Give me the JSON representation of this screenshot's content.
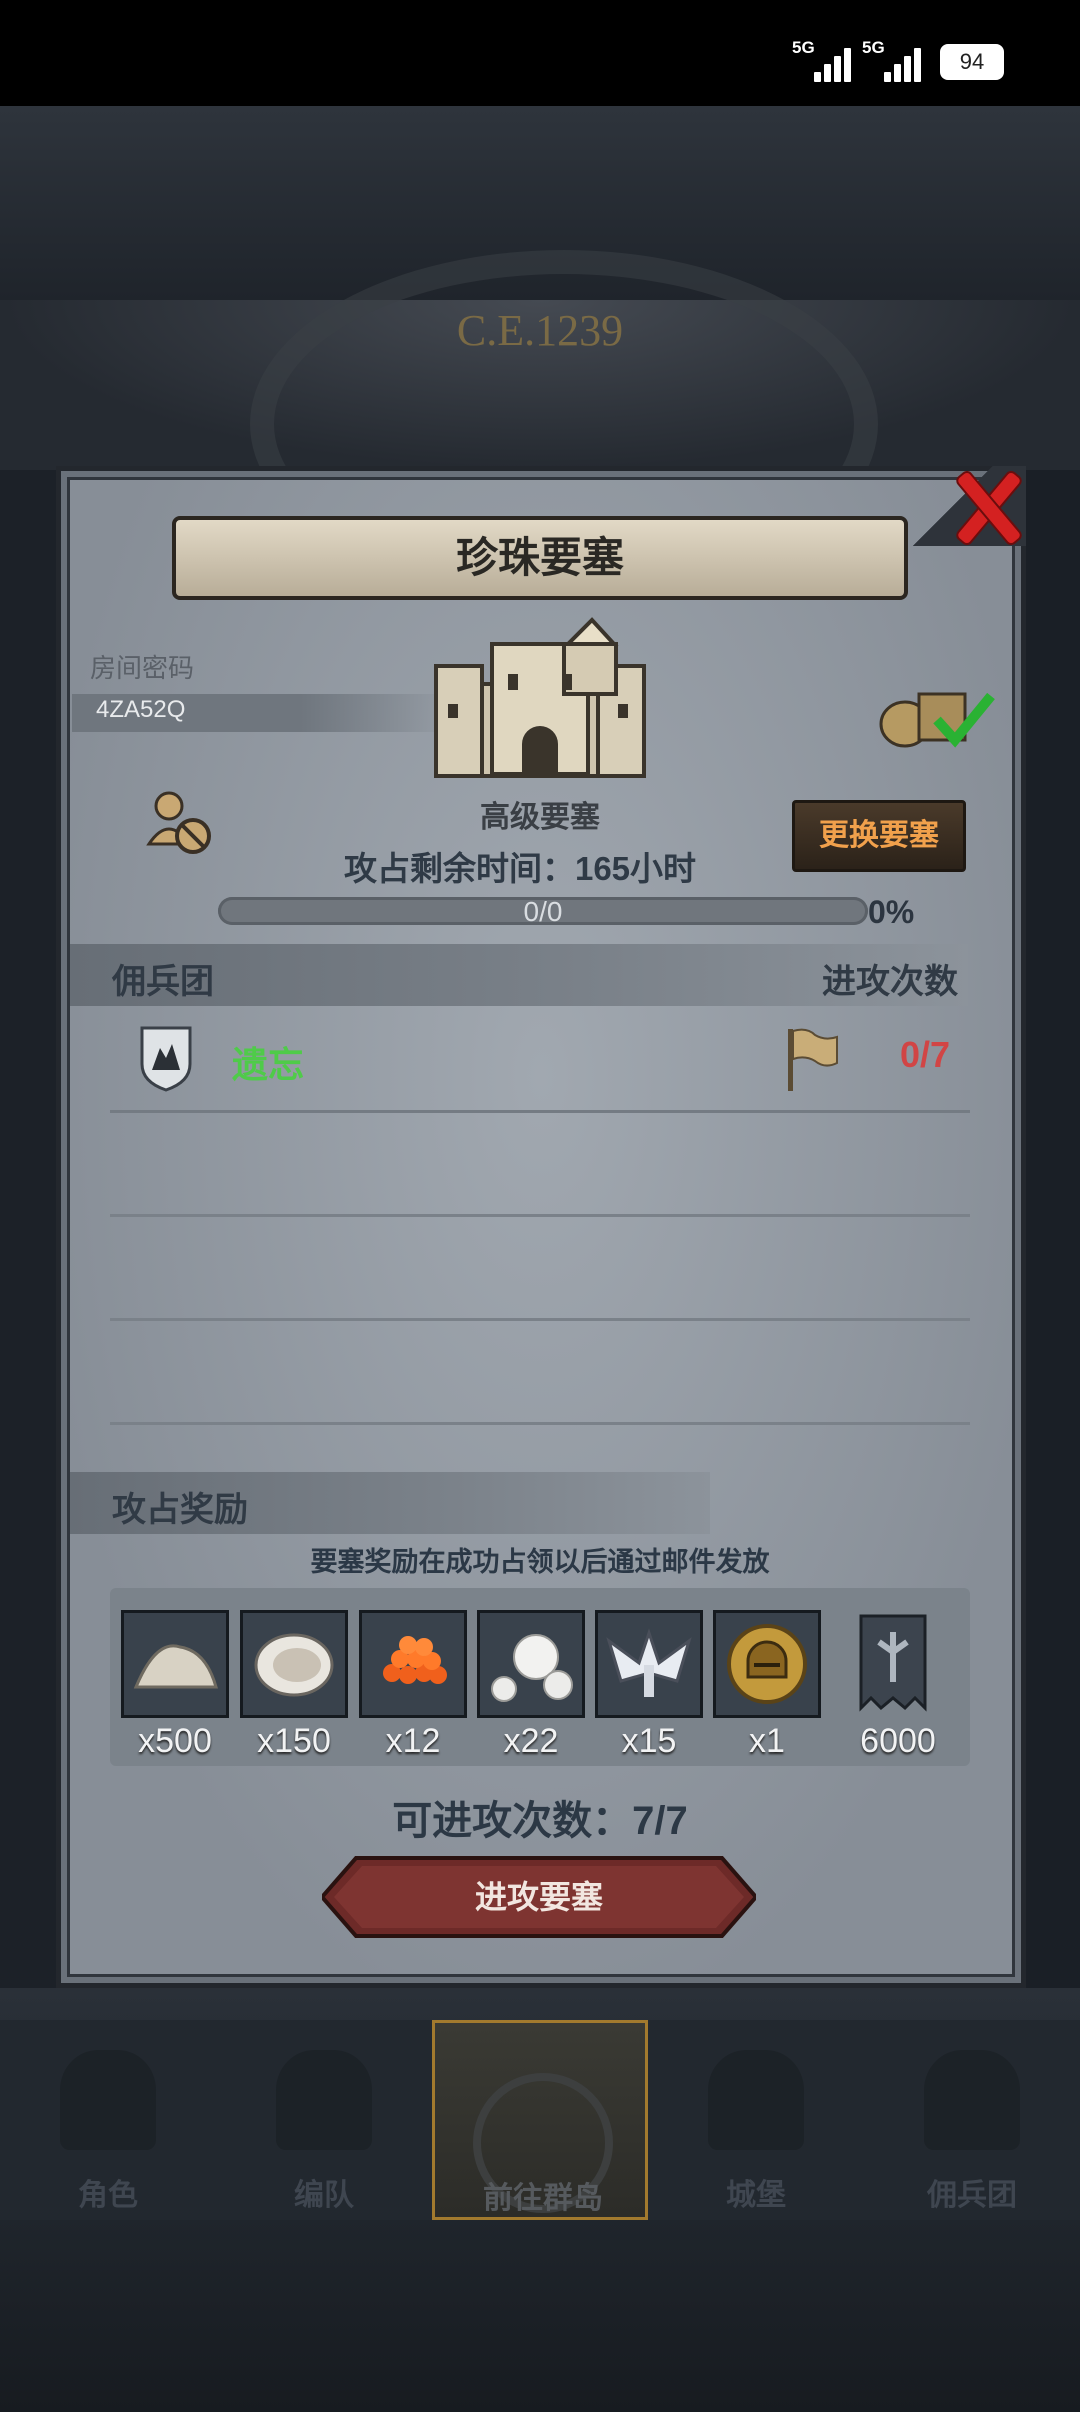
{
  "status_bar": {
    "signal1_label": "5G",
    "signal2_label": "5G",
    "battery": "94"
  },
  "header": {
    "era": "C.E.1239"
  },
  "modal": {
    "title": "珍珠要塞",
    "room_code_label": "房间密码",
    "room_code": "4ZA52Q",
    "fortress_level": "高级要塞",
    "swap_button": "更换要塞",
    "timer_text": "攻占剩余时间：165小时",
    "progress_text": "0/0",
    "progress_fraction": 0,
    "progress_percent": "0%",
    "mercenary_header": "佣兵团",
    "attacks_header": "进攻次数",
    "guilds": [
      {
        "name": "遗忘",
        "attacks": "0/7"
      }
    ],
    "rewards_header": "攻占奖励",
    "rewards_note": "要塞奖励在成功占领以后通过邮件发放",
    "rewards": [
      {
        "icon": "salt-pile-icon",
        "qty": "x500"
      },
      {
        "icon": "oyster-icon",
        "qty": "x150"
      },
      {
        "icon": "fish-roe-icon",
        "qty": "x12"
      },
      {
        "icon": "pearl-icon",
        "qty": "x22"
      },
      {
        "icon": "winged-emblem-icon",
        "qty": "x15"
      },
      {
        "icon": "helmet-coin-icon",
        "qty": "x1"
      },
      {
        "icon": "banner-icon",
        "qty": "6000"
      }
    ],
    "remaining_attacks": "可进攻次数：7/7",
    "attack_button": "进攻要塞"
  },
  "nav": {
    "items": [
      {
        "label": "角色",
        "icon": "character-icon"
      },
      {
        "label": "编队",
        "icon": "formation-icon"
      },
      {
        "label": "前往群岛",
        "icon": "archipelago-icon"
      },
      {
        "label": "城堡",
        "icon": "castle-icon"
      },
      {
        "label": "佣兵团",
        "icon": "mercenary-icon"
      }
    ]
  },
  "colors": {
    "accent_green": "#4fcb49",
    "accent_red": "#d14545",
    "button_orange": "#f1a14c",
    "close_red": "#d42121"
  }
}
